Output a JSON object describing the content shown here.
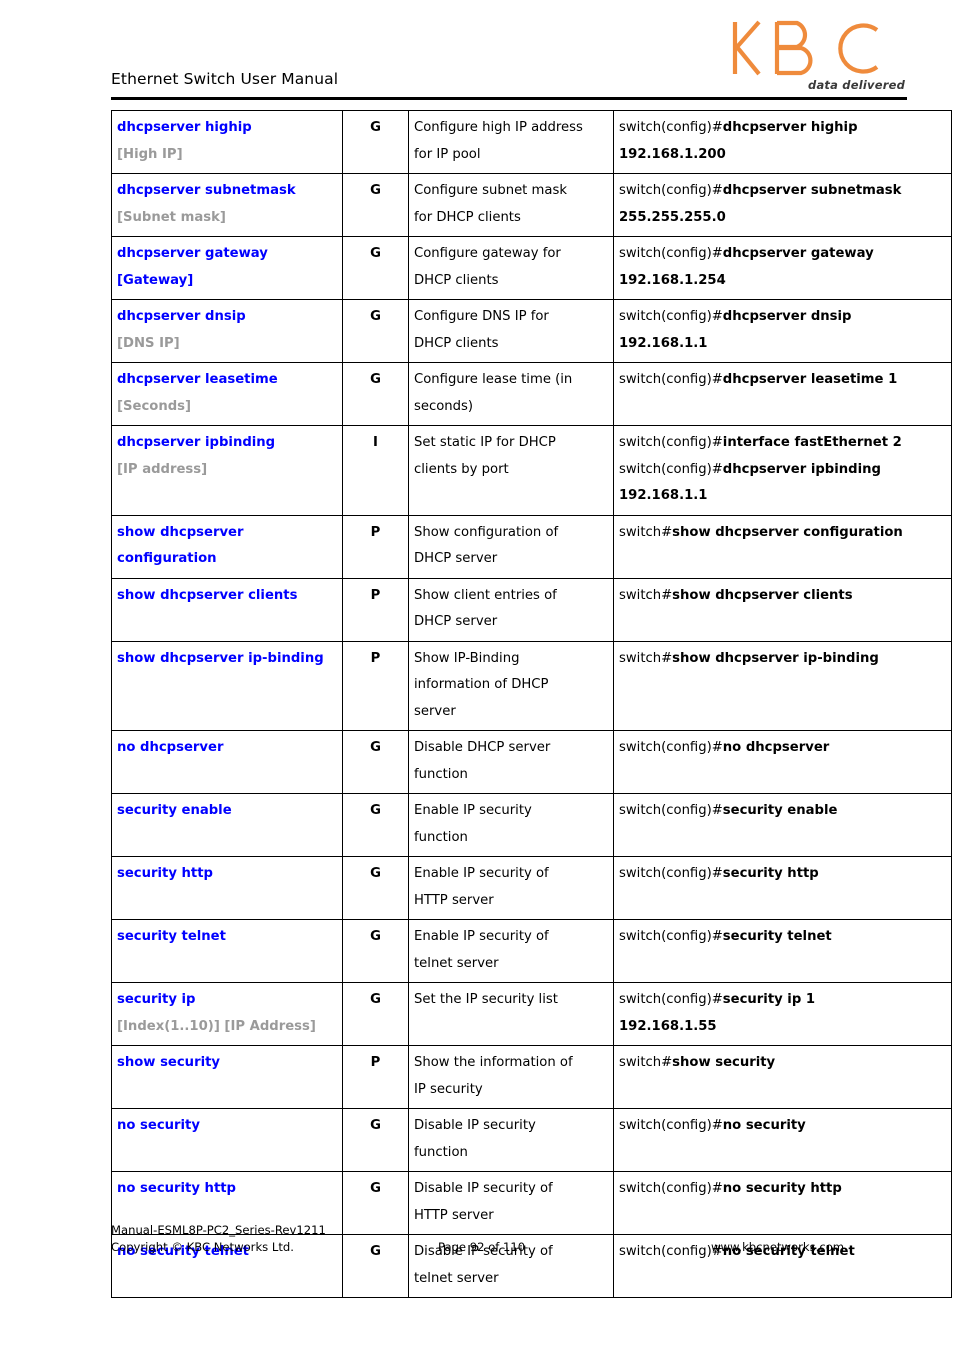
{
  "header": {
    "title": "Ethernet Switch User Manual",
    "logo_text": "KBC",
    "logo_tagline": "data delivered",
    "logo_color": "#ef8b3c"
  },
  "table": {
    "rows": [
      {
        "command": "dhcpserver highip",
        "param": "[High IP]",
        "param_style": "gray",
        "mode": "G",
        "description": [
          "Configure high IP address",
          "for IP pool"
        ],
        "example": [
          {
            "prompt": "switch(config)#",
            "cmd": "dhcpserver highip"
          },
          {
            "prompt": "",
            "cmd": "192.168.1.200"
          }
        ]
      },
      {
        "command": "dhcpserver subnetmask",
        "param": "[Subnet mask]",
        "param_style": "gray",
        "mode": "G",
        "description": [
          "Configure subnet mask",
          "for DHCP clients"
        ],
        "example": [
          {
            "prompt": "switch(config)#",
            "cmd": "dhcpserver subnetmask"
          },
          {
            "prompt": "",
            "cmd": "255.255.255.0"
          }
        ]
      },
      {
        "command": "dhcpserver gateway",
        "param": "[Gateway]",
        "param_style": "blue",
        "mode": "G",
        "description": [
          "Configure gateway for",
          "DHCP clients"
        ],
        "example": [
          {
            "prompt": "switch(config)#",
            "cmd": "dhcpserver gateway"
          },
          {
            "prompt": "",
            "cmd": "192.168.1.254"
          }
        ]
      },
      {
        "command": "dhcpserver dnsip",
        "param": "[DNS IP]",
        "param_style": "gray",
        "mode": "G",
        "description": [
          "Configure DNS IP for",
          "DHCP clients"
        ],
        "example": [
          {
            "prompt": "switch(config)#",
            "cmd": "dhcpserver dnsip"
          },
          {
            "prompt": "",
            "cmd": "192.168.1.1"
          }
        ]
      },
      {
        "command": "dhcpserver leasetime",
        "param": "[Seconds]",
        "param_style": "gray",
        "mode": "G",
        "description": [
          "Configure lease time (in",
          "seconds)"
        ],
        "example": [
          {
            "prompt": "switch(config)#",
            "cmd": "dhcpserver leasetime 1"
          }
        ]
      },
      {
        "command": "dhcpserver ipbinding",
        "param": "[IP address]",
        "param_style": "gray",
        "mode": "I",
        "description": [
          "Set static IP for DHCP",
          "clients by port"
        ],
        "example": [
          {
            "prompt": "switch(config)#",
            "cmd": "interface fastEthernet 2"
          },
          {
            "prompt": "switch(config)#",
            "cmd": "dhcpserver ipbinding"
          },
          {
            "prompt": "",
            "cmd": "192.168.1.1"
          }
        ]
      },
      {
        "command": "show dhcpserver configuration",
        "param": "",
        "param_style": "none",
        "mode": "P",
        "description": [
          "Show configuration of",
          "DHCP server"
        ],
        "example": [
          {
            "prompt": "switch#",
            "cmd": "show dhcpserver configuration"
          }
        ]
      },
      {
        "command": "show dhcpserver clients",
        "param": "",
        "param_style": "none",
        "mode": "P",
        "description": [
          "Show client entries of",
          "DHCP server"
        ],
        "example": [
          {
            "prompt": "switch#",
            "cmd": "show dhcpserver clients"
          }
        ]
      },
      {
        "command": "show dhcpserver ip-binding",
        "param": "",
        "param_style": "none",
        "mode": "P",
        "description": [
          "Show IP-Binding",
          "information of DHCP",
          "server"
        ],
        "example": [
          {
            "prompt": "switch#",
            "cmd": "show dhcpserver ip-binding"
          }
        ]
      },
      {
        "command": "no dhcpserver",
        "param": "",
        "param_style": "none",
        "mode": "G",
        "description": [
          "Disable DHCP server",
          "function"
        ],
        "example": [
          {
            "prompt": "switch(config)#",
            "cmd": "no dhcpserver"
          }
        ]
      },
      {
        "command": "security enable",
        "param": "",
        "param_style": "none",
        "mode": "G",
        "description": [
          "Enable IP security",
          "function"
        ],
        "example": [
          {
            "prompt": "switch(config)#",
            "cmd": "security enable"
          }
        ]
      },
      {
        "command": "security http",
        "param": "",
        "param_style": "none",
        "mode": "G",
        "description": [
          "Enable IP security of",
          "HTTP server"
        ],
        "example": [
          {
            "prompt": "switch(config)#",
            "cmd": "security http"
          }
        ]
      },
      {
        "command": "security telnet",
        "param": "",
        "param_style": "none",
        "mode": "G",
        "description": [
          "Enable IP security of",
          "telnet server"
        ],
        "example": [
          {
            "prompt": "switch(config)#",
            "cmd": "security telnet"
          }
        ]
      },
      {
        "command": "security ip",
        "param": "[Index(1..10)] [IP Address]",
        "param_style": "gray",
        "mode": "G",
        "description": [
          "Set the IP security list"
        ],
        "example": [
          {
            "prompt": "switch(config)#",
            "cmd": "security ip 1"
          },
          {
            "prompt": "",
            "cmd": "192.168.1.55"
          }
        ]
      },
      {
        "command": "show security",
        "param": "",
        "param_style": "none",
        "mode": "P",
        "description": [
          "Show the information of",
          "IP security"
        ],
        "example": [
          {
            "prompt": "switch#",
            "cmd": "show security"
          }
        ]
      },
      {
        "command": "no security",
        "param": "",
        "param_style": "none",
        "mode": "G",
        "description": [
          "Disable IP security",
          "function"
        ],
        "example": [
          {
            "prompt": "switch(config)#",
            "cmd": "no security"
          }
        ]
      },
      {
        "command": "no security http",
        "param": "",
        "param_style": "none",
        "mode": "G",
        "description": [
          "Disable IP security of",
          "HTTP server"
        ],
        "example": [
          {
            "prompt": "switch(config)#",
            "cmd": "no security http"
          }
        ]
      },
      {
        "command": "no security telnet",
        "param": "",
        "param_style": "none",
        "mode": "G",
        "description": [
          "Disable IP security of",
          "telnet server"
        ],
        "example": [
          {
            "prompt": "switch(config)#",
            "cmd": "no security telnet"
          }
        ]
      }
    ]
  },
  "footer": {
    "manual_id": "Manual-ESML8P-PC2_Series-Rev1211",
    "copyright": "Copyright © KBC Networks Ltd.",
    "page": "Page 92 of 110",
    "url": "www.kbcnetworks.com"
  }
}
